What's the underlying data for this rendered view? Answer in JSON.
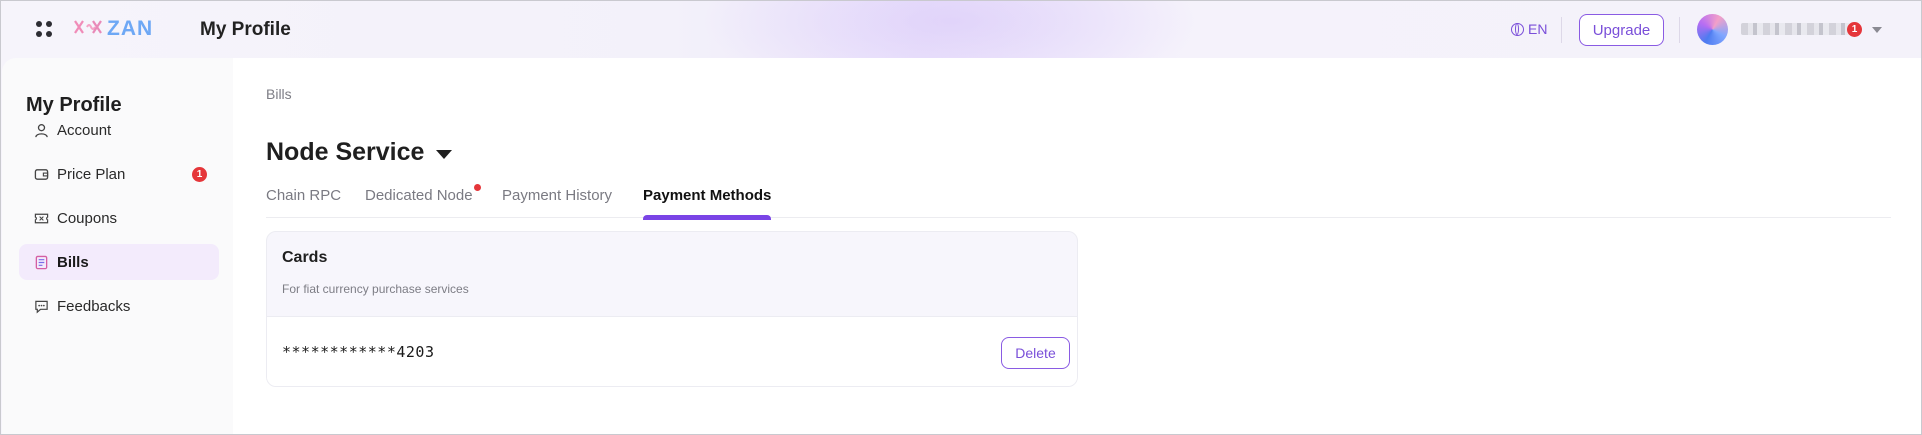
{
  "header": {
    "app_title": "My Profile",
    "logo_text": "ZAN",
    "lang_label": "EN",
    "upgrade_label": "Upgrade",
    "user_badge_count": "1"
  },
  "sidebar": {
    "title": "My Profile",
    "items": [
      {
        "label": "Account",
        "icon": "user-icon"
      },
      {
        "label": "Price Plan",
        "icon": "wallet-icon",
        "badge": "1"
      },
      {
        "label": "Coupons",
        "icon": "ticket-icon"
      },
      {
        "label": "Bills",
        "icon": "document-icon",
        "active": true
      },
      {
        "label": "Feedbacks",
        "icon": "message-icon"
      }
    ]
  },
  "main": {
    "breadcrumb": "Bills",
    "section_title": "Node Service",
    "tabs": [
      {
        "label": "Chain RPC"
      },
      {
        "label": "Dedicated Node",
        "has_dot": true
      },
      {
        "label": "Payment History"
      },
      {
        "label": "Payment Methods",
        "active": true
      }
    ],
    "cards": {
      "title": "Cards",
      "subtitle": "For fiat currency purchase services",
      "items": [
        {
          "number": "************4203",
          "action_label": "Delete"
        }
      ]
    }
  },
  "colors": {
    "accent": "#7a44e6",
    "badge": "#e5363a",
    "active_nav_bg": "#f3ebfc"
  }
}
